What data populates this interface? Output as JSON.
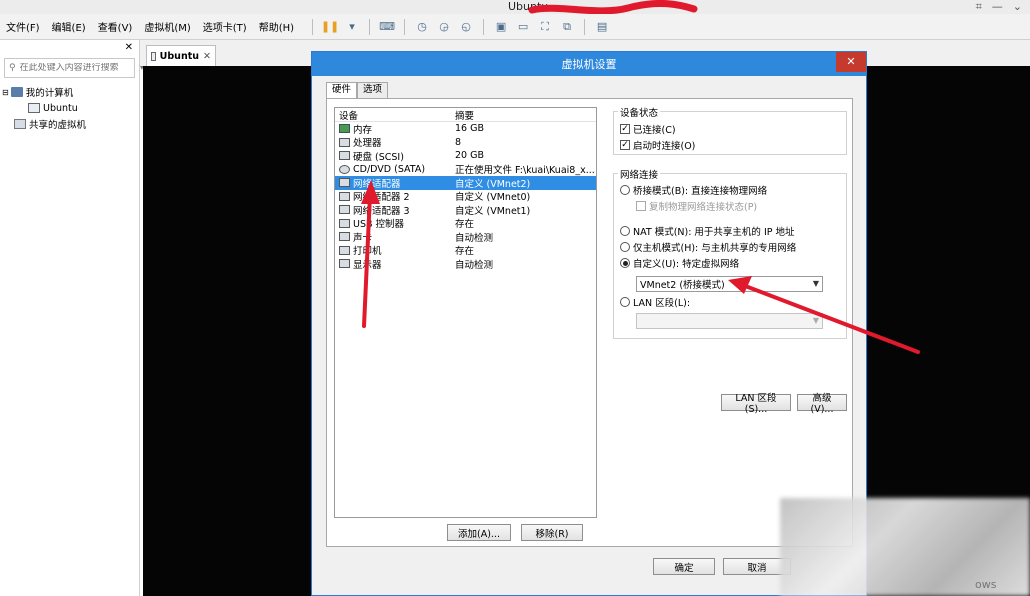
{
  "window": {
    "title": "Ubuntu",
    "controls": [
      "⌗",
      "—",
      "⌄"
    ]
  },
  "menu": [
    "文件(F)",
    "编辑(E)",
    "查看(V)",
    "虚拟机(M)",
    "选项卡(T)",
    "帮助(H)"
  ],
  "library": {
    "close": "✕",
    "search_placeholder": "在此处键入内容进行搜索",
    "tree": [
      {
        "label": "我的计算机",
        "icon": "computer-icon"
      },
      {
        "label": "Ubuntu",
        "icon": "vm-icon"
      },
      {
        "label": "共享的虚拟机",
        "icon": "shared-vm-icon"
      }
    ]
  },
  "workspace": {
    "tab_label": "Ubuntu",
    "tab_close": "✕"
  },
  "dialog": {
    "title": "虚拟机设置",
    "close": "✕",
    "tabs": [
      "硬件",
      "选项"
    ],
    "device_table": {
      "headers": [
        "设备",
        "摘要"
      ],
      "rows": [
        {
          "device": "内存",
          "summary": "16 GB"
        },
        {
          "device": "处理器",
          "summary": "8"
        },
        {
          "device": "硬盘 (SCSI)",
          "summary": "20 GB"
        },
        {
          "device": "CD/DVD (SATA)",
          "summary": "正在使用文件 F:\\kuai\\Kuai8_x..."
        },
        {
          "device": "网络适配器",
          "summary": "自定义 (VMnet2)",
          "selected": true
        },
        {
          "device": "网络适配器 2",
          "summary": "自定义 (VMnet0)"
        },
        {
          "device": "网络适配器 3",
          "summary": "自定义 (VMnet1)"
        },
        {
          "device": "USB 控制器",
          "summary": "存在"
        },
        {
          "device": "声卡",
          "summary": "自动检测"
        },
        {
          "device": "打印机",
          "summary": "存在"
        },
        {
          "device": "显示器",
          "summary": "自动检测"
        }
      ],
      "add_button": "添加(A)...",
      "remove_button": "移除(R)"
    },
    "device_status": {
      "legend": "设备状态",
      "connected": "已连接(C)",
      "connect_on_power": "启动时连接(O)"
    },
    "network": {
      "legend": "网络连接",
      "bridged": "桥接模式(B): 直接连接物理网络",
      "replicate": "复制物理网络连接状态(P)",
      "nat": "NAT 模式(N): 用于共享主机的 IP 地址",
      "host_only": "仅主机模式(H): 与主机共享的专用网络",
      "custom": "自定义(U): 特定虚拟网络",
      "custom_value": "VMnet2 (桥接模式)",
      "lan_segment": "LAN 区段(L):",
      "lan_segment_value": "",
      "lan_segments_button": "LAN 区段(S)...",
      "advanced_button": "高级(V)..."
    },
    "ok": "确定",
    "cancel": "取消"
  },
  "watermark_text": "ows",
  "colors": {
    "title_blue": "#2e88db",
    "selection": "#2f8de4",
    "annotation_red": "#e0192c"
  }
}
